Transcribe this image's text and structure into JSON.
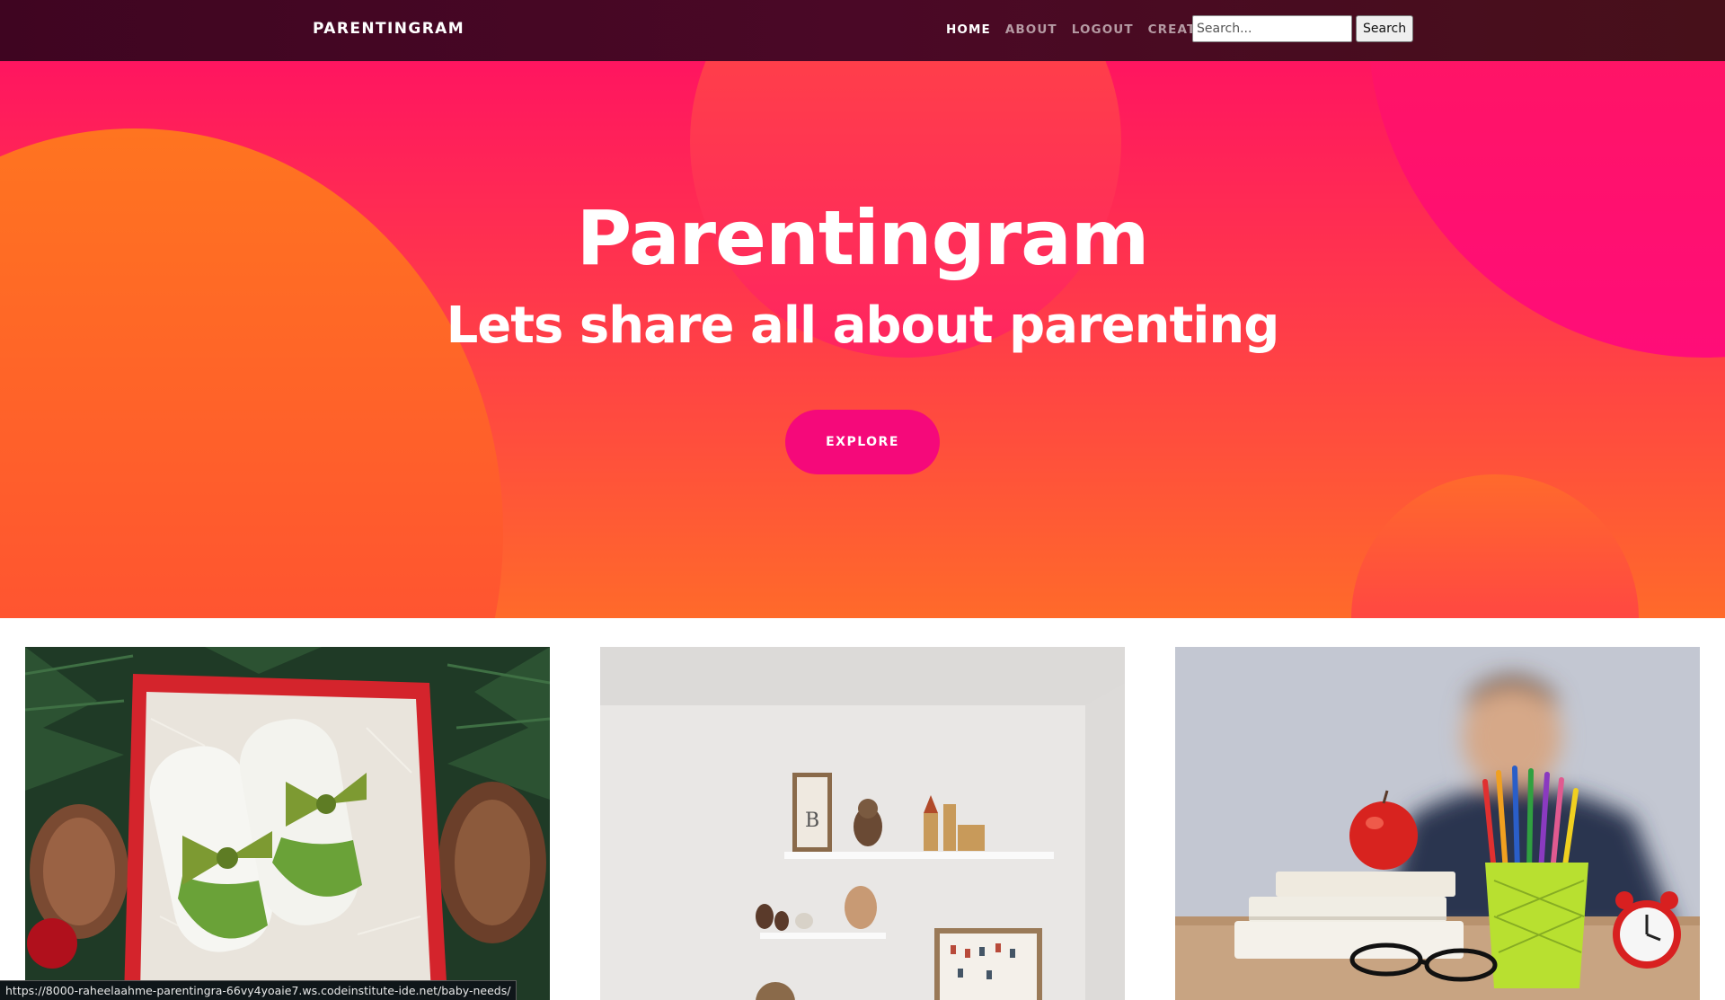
{
  "navbar": {
    "brand": "PARENTINGRAM",
    "links": [
      {
        "label": "HOME",
        "active": true
      },
      {
        "label": "ABOUT",
        "active": false
      },
      {
        "label": "LOGOUT",
        "active": false
      },
      {
        "label": "CREATE",
        "active": false
      }
    ],
    "search": {
      "placeholder": "Search...",
      "value": "",
      "button_label": "Search"
    }
  },
  "hero": {
    "title": "Parentingram",
    "subtitle": "Lets share all about parenting",
    "cta_label": "EXPLORE"
  },
  "posts": [
    {
      "image_subject": "baby socks with green bows in a red gift box"
    },
    {
      "image_subject": "nursery wall shelves with toys and framed pictures"
    },
    {
      "image_subject": "child with books, apple and pencil cup"
    }
  ],
  "status_bar": {
    "url": "https://8000-raheelaahme-parentingra-66vy4yoaie7.ws.codeinstitute-ide.net/baby-needs/"
  },
  "colors": {
    "navbar": "#420620",
    "hero_pink": "#ff1560",
    "hero_orange": "#ff6a2a",
    "cta": "#f5097a"
  }
}
